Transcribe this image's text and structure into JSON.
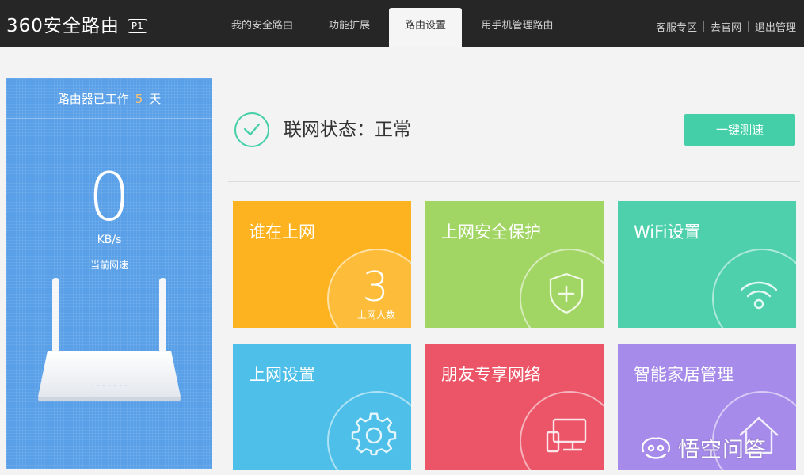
{
  "header": {
    "logo_text": "360安全路由",
    "logo_badge": "P1",
    "tabs": [
      {
        "label": "我的安全路由",
        "active": false
      },
      {
        "label": "功能扩展",
        "active": false
      },
      {
        "label": "路由设置",
        "active": true
      },
      {
        "label": "用手机管理路由",
        "active": false
      }
    ],
    "links": [
      "客服专区",
      "去官网",
      "退出管理"
    ]
  },
  "left_panel": {
    "work_prefix": "路由器已工作",
    "work_days": "5",
    "work_suffix": "天",
    "speed_value": "0",
    "speed_unit": "KB/s",
    "speed_label": "当前网速",
    "router_leds": "· · · · · · ·"
  },
  "status": {
    "text": "联网状态：正常",
    "button_label": "一键测速"
  },
  "tiles": [
    {
      "title": "谁在上网",
      "count": "3",
      "count_label": "上网人数",
      "color": "#fdb31f",
      "icon": "users-count"
    },
    {
      "title": "上网安全保护",
      "color": "#a2d664",
      "icon": "shield-plus-icon"
    },
    {
      "title": "WiFi设置",
      "color": "#4dd0ab",
      "icon": "wifi-icon"
    },
    {
      "title": "上网设置",
      "color": "#4dbfe8",
      "icon": "gear-icon"
    },
    {
      "title": "朋友专享网络",
      "color": "#ec5568",
      "icon": "devices-icon"
    },
    {
      "title": "智能家居管理",
      "color": "#a68bea",
      "icon": "home-icon"
    }
  ],
  "colors": {
    "topbar": "#262626",
    "left_panel": "#5aa0e8",
    "accent": "#44cfa8",
    "days_highlight": "#ffc36a"
  },
  "watermark": {
    "text": "悟空问答"
  }
}
